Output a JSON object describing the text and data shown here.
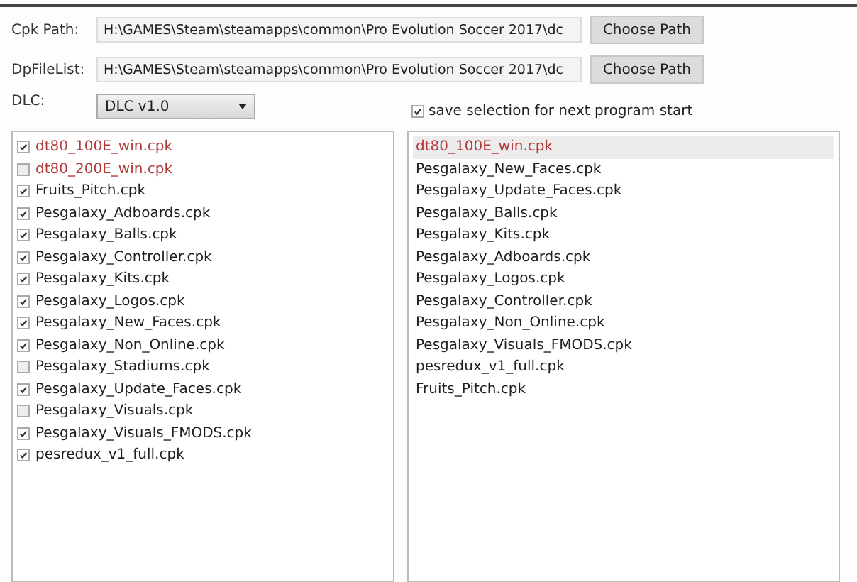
{
  "paths": [
    {
      "label": "Cpk Path:",
      "value": "H:\\GAMES\\Steam\\steamapps\\common\\Pro Evolution Soccer 2017\\dc",
      "button": "Choose Path"
    },
    {
      "label": "DpFileList:",
      "value": "H:\\GAMES\\Steam\\steamapps\\common\\Pro Evolution Soccer 2017\\dc",
      "button": "Choose Path"
    }
  ],
  "dlc": {
    "label": "DLC:",
    "value": "DLC v1.0"
  },
  "save_selection": {
    "label": "save selection for next program start",
    "checked": true
  },
  "available_files": [
    {
      "name": "dt80_100E_win.cpk",
      "checked": true,
      "color": "#b23a3a"
    },
    {
      "name": "dt80_200E_win.cpk",
      "checked": false,
      "color": "#b23a3a"
    },
    {
      "name": "Fruits_Pitch.cpk",
      "checked": true,
      "color": "#1e1e1e"
    },
    {
      "name": "Pesgalaxy_Adboards.cpk",
      "checked": true,
      "color": "#1e1e1e"
    },
    {
      "name": "Pesgalaxy_Balls.cpk",
      "checked": true,
      "color": "#1e1e1e"
    },
    {
      "name": "Pesgalaxy_Controller.cpk",
      "checked": true,
      "color": "#1e1e1e"
    },
    {
      "name": "Pesgalaxy_Kits.cpk",
      "checked": true,
      "color": "#1e1e1e"
    },
    {
      "name": "Pesgalaxy_Logos.cpk",
      "checked": true,
      "color": "#1e1e1e"
    },
    {
      "name": "Pesgalaxy_New_Faces.cpk",
      "checked": true,
      "color": "#1e1e1e"
    },
    {
      "name": "Pesgalaxy_Non_Online.cpk",
      "checked": true,
      "color": "#1e1e1e"
    },
    {
      "name": "Pesgalaxy_Stadiums.cpk",
      "checked": false,
      "color": "#1e1e1e"
    },
    {
      "name": "Pesgalaxy_Update_Faces.cpk",
      "checked": true,
      "color": "#1e1e1e"
    },
    {
      "name": "Pesgalaxy_Visuals.cpk",
      "checked": false,
      "color": "#1e1e1e"
    },
    {
      "name": "Pesgalaxy_Visuals_FMODS.cpk",
      "checked": true,
      "color": "#1e1e1e"
    },
    {
      "name": "pesredux_v1_full.cpk",
      "checked": true,
      "color": "#1e1e1e"
    }
  ],
  "load_order": [
    {
      "name": "dt80_100E_win.cpk",
      "selected": true,
      "color": "#b23a3a"
    },
    {
      "name": "Pesgalaxy_New_Faces.cpk",
      "selected": false,
      "color": "#1e1e1e"
    },
    {
      "name": "Pesgalaxy_Update_Faces.cpk",
      "selected": false,
      "color": "#1e1e1e"
    },
    {
      "name": "Pesgalaxy_Balls.cpk",
      "selected": false,
      "color": "#1e1e1e"
    },
    {
      "name": "Pesgalaxy_Kits.cpk",
      "selected": false,
      "color": "#1e1e1e"
    },
    {
      "name": "Pesgalaxy_Adboards.cpk",
      "selected": false,
      "color": "#1e1e1e"
    },
    {
      "name": "Pesgalaxy_Logos.cpk",
      "selected": false,
      "color": "#1e1e1e"
    },
    {
      "name": "Pesgalaxy_Controller.cpk",
      "selected": false,
      "color": "#1e1e1e"
    },
    {
      "name": "Pesgalaxy_Non_Online.cpk",
      "selected": false,
      "color": "#1e1e1e"
    },
    {
      "name": "Pesgalaxy_Visuals_FMODS.cpk",
      "selected": false,
      "color": "#1e1e1e"
    },
    {
      "name": "pesredux_v1_full.cpk",
      "selected": false,
      "color": "#1e1e1e"
    },
    {
      "name": "Fruits_Pitch.cpk",
      "selected": false,
      "color": "#1e1e1e"
    }
  ]
}
